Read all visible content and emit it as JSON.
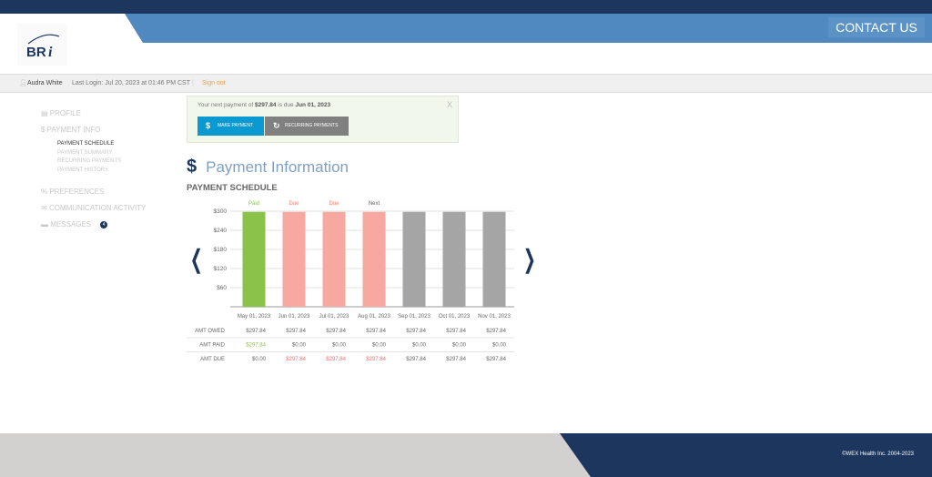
{
  "header": {
    "contact_label": "CONTACT US",
    "logo_text": "BRI"
  },
  "userbar": {
    "user_name": "Audra White",
    "last_login": "Last Login: Jul 20, 2023 at 01:46 PM CST",
    "sign_out": "Sign out"
  },
  "sidebar": {
    "items": [
      {
        "label": "PROFILE",
        "icon": "id-card-icon"
      },
      {
        "label": "PAYMENT INFO",
        "icon": "dollar-icon"
      },
      {
        "label": "PREFERENCES",
        "icon": "sliders-icon"
      },
      {
        "label": "COMMUNICATION ACTIVITY",
        "icon": "envelope-icon"
      },
      {
        "label": "MESSAGES",
        "icon": "chat-icon",
        "badge": "4"
      }
    ],
    "sub_items": [
      {
        "label": "PAYMENT SCHEDULE",
        "active": true
      },
      {
        "label": "PAYMENT SUMMARY"
      },
      {
        "label": "RECURRING PAYMENTS"
      },
      {
        "label": "PAYMENT HISTORY"
      }
    ]
  },
  "alert": {
    "prefix": "Your next payment of ",
    "amount": "$297.84",
    "middle": " is due ",
    "date": "Jun 01, 2023",
    "close": "X",
    "make_payment": "MAKE PAYMENT",
    "recurring": "RECURRING PAYMENTS"
  },
  "page": {
    "title": "Payment Information",
    "section": "PAYMENT SCHEDULE",
    "prev": "❮",
    "next": "❯"
  },
  "colors": {
    "paid": "#8bc34a",
    "due": "#f7a9a1",
    "future": "#a5a5a6",
    "navy": "#1c365e",
    "accent": "#0a9ad1",
    "signout": "#f0a040"
  },
  "chart_data": {
    "type": "bar",
    "ylim": [
      0,
      300
    ],
    "yticks": [
      "$60",
      "$120",
      "$180",
      "$240",
      "$300"
    ],
    "ytick_values": [
      60,
      120,
      180,
      240,
      300
    ],
    "categories": [
      "May 01, 2023",
      "Jun 01, 2023",
      "Jul 01, 2023",
      "Aug 01, 2023",
      "Sep 01, 2023",
      "Oct 01, 2023",
      "Nov 01, 2023"
    ],
    "values": [
      297.84,
      297.84,
      297.84,
      297.84,
      297.84,
      297.84,
      297.84
    ],
    "status": [
      "paid",
      "due",
      "due",
      "due",
      "future",
      "future",
      "future"
    ],
    "bar_labels": [
      "Paid",
      "Due",
      "Due",
      "Next",
      "",
      "",
      ""
    ],
    "grid": true,
    "table": {
      "rows": [
        {
          "label": "AMT OWED",
          "values": [
            "$297.84",
            "$297.84",
            "$297.84",
            "$297.84",
            "$297.84",
            "$297.84",
            "$297.84"
          ],
          "colors": [
            "",
            "",
            "",
            "",
            "",
            "",
            ""
          ]
        },
        {
          "label": "AMT PAID",
          "values": [
            "$297.84",
            "$0.00",
            "$0.00",
            "$0.00",
            "$0.00",
            "$0.00",
            "$0.00"
          ],
          "colors": [
            "paid",
            "",
            "",
            "",
            "",
            "",
            ""
          ]
        },
        {
          "label": "AMT DUE",
          "values": [
            "$0.00",
            "$297.84",
            "$297.84",
            "$297.84",
            "$297.84",
            "$297.84",
            "$297.84"
          ],
          "colors": [
            "",
            "due",
            "due",
            "due",
            "",
            "",
            ""
          ]
        }
      ]
    }
  },
  "footer": {
    "copyright": "©WEX Health Inc. 2004-2023"
  }
}
